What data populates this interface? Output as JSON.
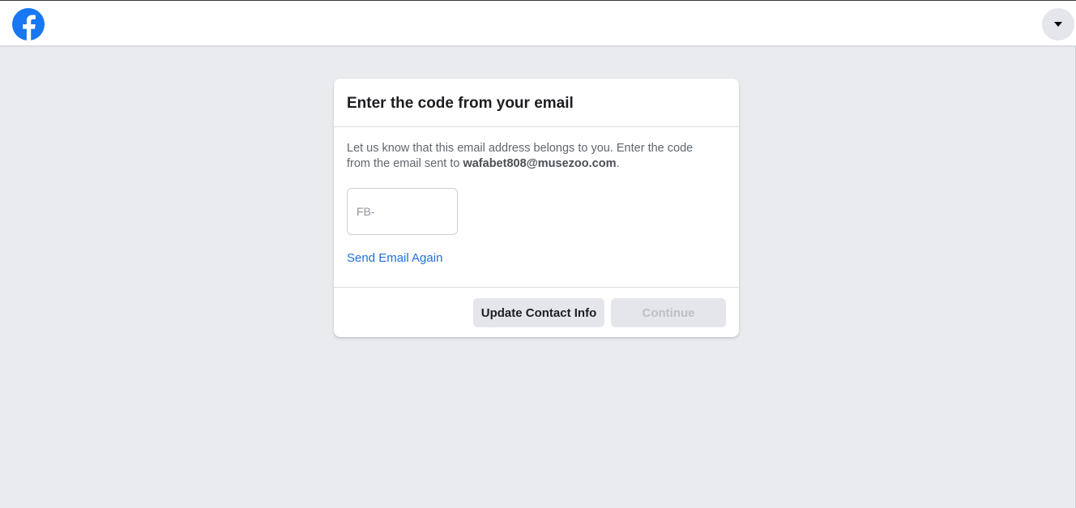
{
  "header": {
    "logo_icon": "facebook-logo",
    "brand_color": "#1877f2",
    "account_menu_icon": "caret-down-icon"
  },
  "dialog": {
    "title": "Enter the code from your email",
    "description_prefix": "Let us know that this email address belongs to you. Enter the code from the email sent to ",
    "email": "wafabet808@musezoo.com",
    "description_suffix": ".",
    "code_input": {
      "value": "",
      "placeholder": "FB-"
    },
    "resend_link": "Send Email Again",
    "update_button": "Update Contact Info",
    "continue_button": "Continue",
    "continue_enabled": false
  }
}
